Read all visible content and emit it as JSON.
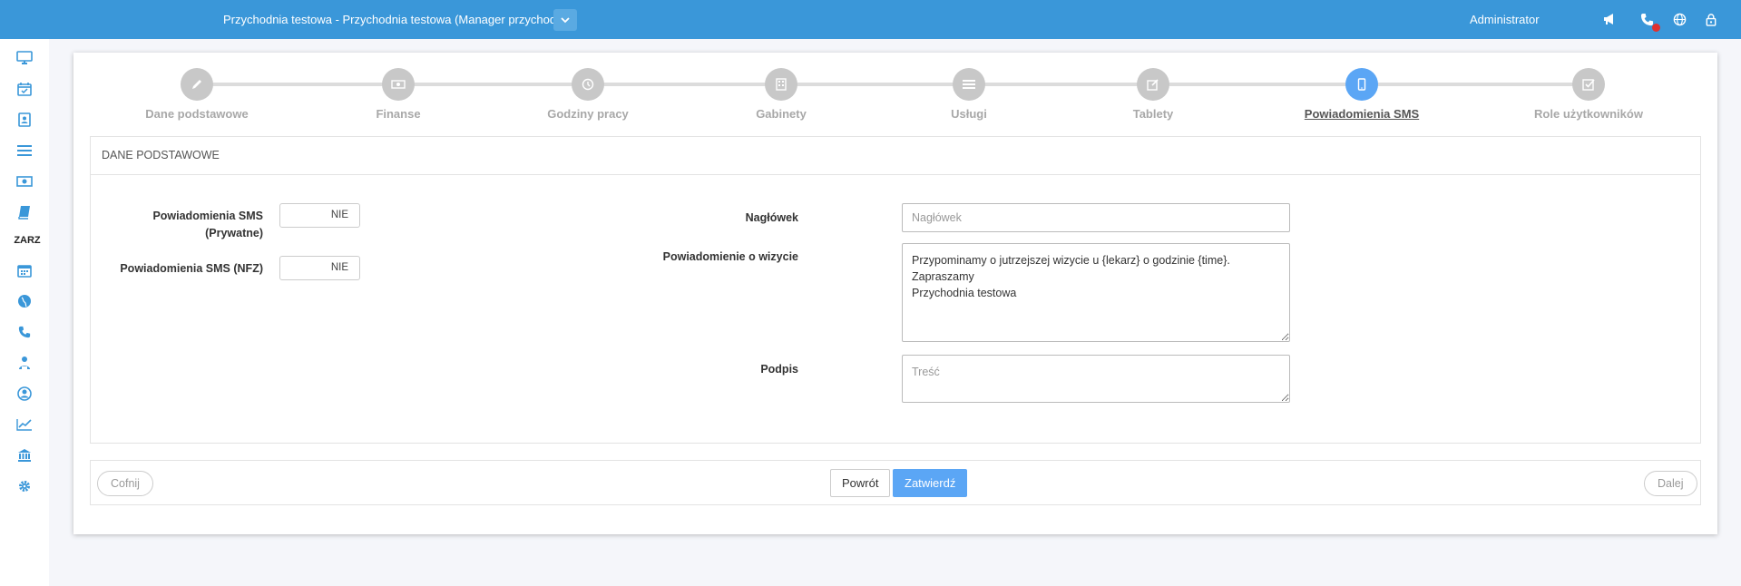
{
  "topbar": {
    "title": "Przychodnia testowa - Przychodnia testowa (Manager przychodni)",
    "user": "Administrator",
    "icons": [
      "megaphone-icon",
      "phone-icon",
      "globe-icon",
      "lock-icon"
    ]
  },
  "sidebar": {
    "section_label": "ZARZ",
    "items": [
      "desktop-icon",
      "calendar-check-icon",
      "contact-card-icon",
      "list-icon",
      "money-icon",
      "book-icon",
      "calendar-icon",
      "globe-icon",
      "phone-icon",
      "user-tie-icon",
      "user-circle-icon",
      "chart-line-icon",
      "bank-icon",
      "gear-icon"
    ]
  },
  "stepper": {
    "steps": [
      {
        "label": "Dane podstawowe",
        "icon": "pencil-icon"
      },
      {
        "label": "Finanse",
        "icon": "money-icon"
      },
      {
        "label": "Godziny pracy",
        "icon": "clock-icon"
      },
      {
        "label": "Gabinety",
        "icon": "building-icon"
      },
      {
        "label": "Usługi",
        "icon": "list-icon"
      },
      {
        "label": "Tablety",
        "icon": "edit-icon"
      },
      {
        "label": "Powiadomienia SMS",
        "icon": "mobile-icon"
      },
      {
        "label": "Role użytkowników",
        "icon": "checkbox-icon"
      }
    ],
    "active": 6
  },
  "section": {
    "title": "DANE PODSTAWOWE",
    "sms_private_label_1": "Powiadomienia SMS",
    "sms_private_label_2": "(Prywatne)",
    "sms_private_value": "NIE",
    "sms_nfz_label": "Powiadomienia SMS (NFZ)",
    "sms_nfz_value": "NIE",
    "header_label": "Nagłówek",
    "header_placeholder": "Nagłówek",
    "visit_label": "Powiadomienie o wizycie",
    "visit_value": "Przypominamy o jutrzejszej wizycie u {lekarz} o godzinie {time}.\nZapraszamy\nPrzychodnia testowa",
    "signature_label": "Podpis",
    "signature_placeholder": "Treść"
  },
  "footer": {
    "prev": "Cofnij",
    "back": "Powrót",
    "confirm": "Zatwierdź",
    "next": "Dalej"
  },
  "colors": {
    "topbar": "#3a97d9",
    "active_step": "#5ba6f5",
    "inactive_step": "#c8c8c8"
  }
}
